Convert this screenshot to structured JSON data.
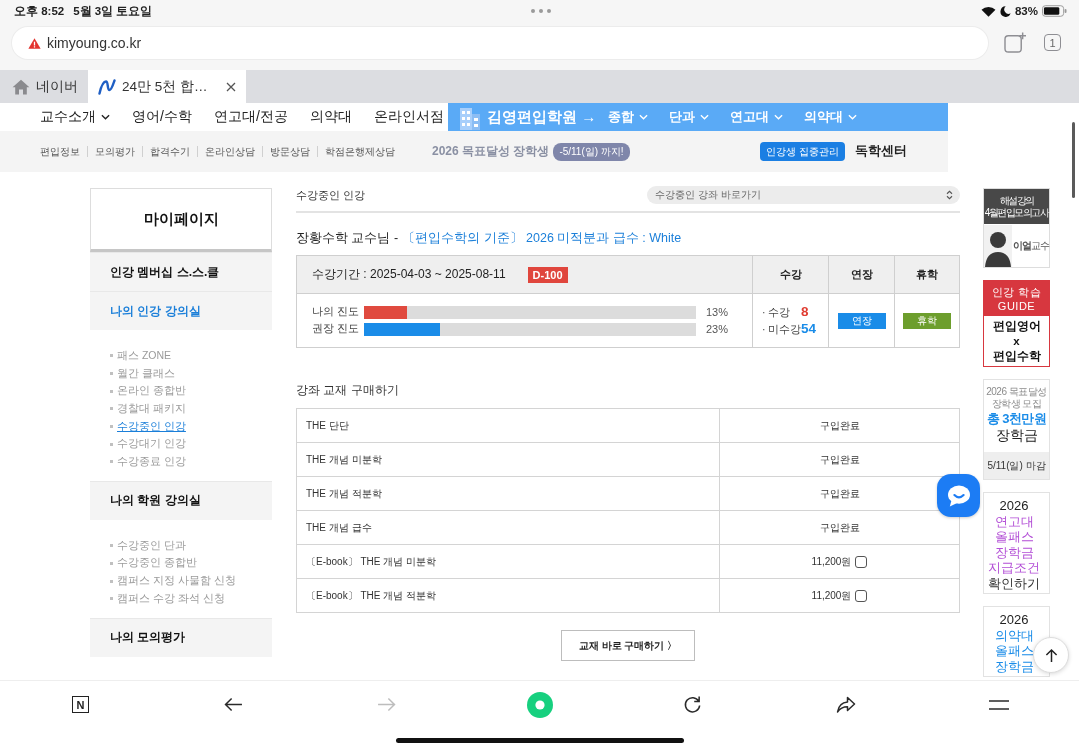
{
  "status_bar": {
    "time": "오후 8:52",
    "date": "5월 3일 토요일",
    "battery": "83%"
  },
  "browser": {
    "url": "kimyoung.co.kr",
    "insecure": true,
    "tab_count": "1",
    "tabs": [
      {
        "label": "네이버",
        "kind": "home",
        "selected": false
      },
      {
        "label": "24만 5천 합…",
        "kind": "site",
        "selected": true
      }
    ]
  },
  "site_header": {
    "menu": [
      {
        "label": "교수소개",
        "dropdown": true
      },
      {
        "label": "영어/수학",
        "dropdown": false
      },
      {
        "label": "연고대/전공",
        "dropdown": false
      },
      {
        "label": "의약대",
        "dropdown": false
      },
      {
        "label": "온라인서점",
        "dropdown": false
      }
    ],
    "banner": {
      "title": "김영편입학원 →",
      "menu": [
        {
          "label": "종합",
          "dropdown": true
        },
        {
          "label": "단과",
          "dropdown": true
        },
        {
          "label": "연고대",
          "dropdown": true
        },
        {
          "label": "의약대",
          "dropdown": true
        }
      ]
    },
    "links": [
      "편입정보",
      "모의평가",
      "합격수기",
      "온라인상담",
      "방문상담",
      "학점은행제상담"
    ],
    "promo": {
      "title": "2026 목표달성 장학생",
      "badge": "-5/11(일) 까지!"
    },
    "focus_button": "인강생 집중관리",
    "study_center": "독학센터"
  },
  "sidebar": {
    "title": "마이페이지",
    "sections": [
      {
        "label": "인강 멤버십 스.스.클",
        "selected": false
      },
      {
        "label": "나의 인강 강의실",
        "selected": true,
        "items": [
          {
            "label": "패스 ZONE",
            "selected": false
          },
          {
            "label": "월간 클래스",
            "selected": false
          },
          {
            "label": "온라인 종합반",
            "selected": false
          },
          {
            "label": "경찰대 패키지",
            "selected": false
          },
          {
            "label": "수강중인 인강",
            "selected": true
          },
          {
            "label": "수강대기 인강",
            "selected": false
          },
          {
            "label": "수강종료 인강",
            "selected": false
          }
        ]
      },
      {
        "label": "나의 학원 강의실",
        "selected": false,
        "items": [
          {
            "label": "수강중인 단과",
            "selected": false
          },
          {
            "label": "수강중인 종합반",
            "selected": false
          },
          {
            "label": "캠퍼스 지정 사물함 신청",
            "selected": false
          },
          {
            "label": "캠퍼스 수강 좌석 신청",
            "selected": false
          }
        ]
      },
      {
        "label": "나의 모의평가",
        "selected": false
      }
    ]
  },
  "main": {
    "heading": "수강중인 인강",
    "jump_select": {
      "value": "수강중인 강좌 바로가기"
    },
    "course": {
      "teacher": "장황수학 교수님 -",
      "title": "〔편입수학의 기준〕 2026 미적분과 급수 : White",
      "period": "수강기간 : 2025-04-03 ~ 2025-08-11",
      "d_day": "D-100",
      "columns": [
        "수강",
        "연장",
        "휴학"
      ],
      "progress": [
        {
          "label": "나의 진도",
          "level": 0.13,
          "reading": "13%",
          "color": "#e04a3f"
        },
        {
          "label": "권장 진도",
          "level": 0.23,
          "reading": "23%",
          "color": "#1a8ce8"
        }
      ],
      "counts": [
        {
          "label": "· 수강",
          "value": "8",
          "color": "#e03c31"
        },
        {
          "label": "· 미수강",
          "value": "54",
          "color": "#1a8ce8"
        }
      ],
      "extend_button": "연장",
      "leave_button": "휴학"
    },
    "textbooks": {
      "heading": "강좌 교재 구매하기",
      "rows": [
        {
          "name": "THE 단단",
          "kind": "purchased",
          "status": "구입완료"
        },
        {
          "name": "THE 개념 미분학",
          "kind": "purchased",
          "status": "구입완료"
        },
        {
          "name": "THE 개념 적분학",
          "kind": "purchased",
          "status": "구입완료"
        },
        {
          "name": "THE 개념 급수",
          "kind": "purchased",
          "status": "구입완료"
        },
        {
          "name": "〔E-book〕 THE 개념 미분학",
          "kind": "buyable",
          "price": "11,200원",
          "checked": false
        },
        {
          "name": "〔E-book〕 THE 개념 적분학",
          "kind": "buyable",
          "price": "11,200원",
          "checked": false
        }
      ],
      "buy_button": "교재 바로 구매하기 〉"
    }
  },
  "ads": [
    {
      "kind": "lecture",
      "caption": [
        "해설강의",
        "4월편입모의고사"
      ],
      "name": "**이얼**교수"
    },
    {
      "kind": "guide",
      "header": [
        "인강 학습",
        "GUIDE"
      ],
      "body": [
        "편입영어",
        "x",
        "편입수학"
      ]
    },
    {
      "kind": "scholarship",
      "caption": "2026 목표달성 장학생 모집",
      "amount": "총 3천만원",
      "label": "장학금",
      "footer": "5/11(일) 마감"
    },
    {
      "kind": "promo",
      "lines": [
        {
          "text": "2026",
          "color": "#222222"
        },
        {
          "text": "연고대",
          "color": "#b34fd6"
        },
        {
          "text": "올패스",
          "color": "#b34fd6"
        },
        {
          "text": "장학금",
          "color": "#b34fd6"
        },
        {
          "text": "지급조건",
          "color": "#b34fd6"
        },
        {
          "text": "확인하기",
          "color": "#333333"
        }
      ]
    },
    {
      "kind": "promo",
      "lines": [
        {
          "text": "2026",
          "color": "#222222"
        },
        {
          "text": "의약대",
          "color": "#1a8ce8"
        },
        {
          "text": "올패스",
          "color": "#1a8ce8"
        },
        {
          "text": "장학금",
          "color": "#1a8ce8"
        }
      ]
    }
  ],
  "toolbar": [
    {
      "kind": "naver",
      "label": "N",
      "disabled": false
    },
    {
      "kind": "back",
      "disabled": false
    },
    {
      "kind": "forward",
      "disabled": true
    },
    {
      "kind": "home",
      "disabled": false
    },
    {
      "kind": "reload",
      "disabled": false
    },
    {
      "kind": "share",
      "disabled": false
    },
    {
      "kind": "menu",
      "disabled": false
    }
  ]
}
